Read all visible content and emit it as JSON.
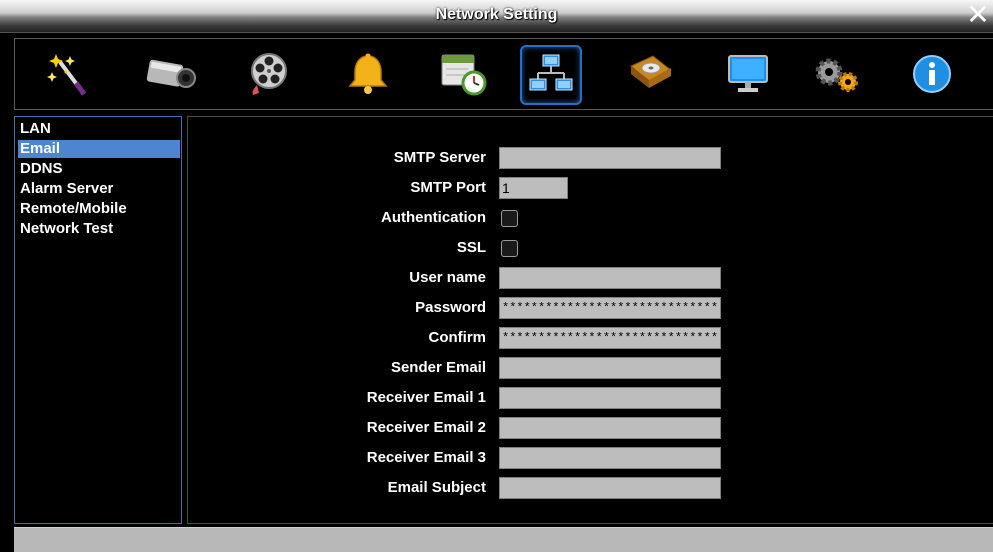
{
  "window": {
    "title": "Network Setting",
    "close_label": "✕"
  },
  "toolbar": {
    "items": [
      {
        "name": "wizard-icon"
      },
      {
        "name": "camera-icon"
      },
      {
        "name": "film-reel-icon"
      },
      {
        "name": "alarm-bell-icon"
      },
      {
        "name": "schedule-icon"
      },
      {
        "name": "network-icon",
        "active": true
      },
      {
        "name": "hard-disk-icon"
      },
      {
        "name": "monitor-icon"
      },
      {
        "name": "settings-gears-icon"
      },
      {
        "name": "info-icon"
      }
    ]
  },
  "sidebar": {
    "items": [
      {
        "label": "LAN"
      },
      {
        "label": "Email",
        "selected": true
      },
      {
        "label": "DDNS"
      },
      {
        "label": "Alarm Server"
      },
      {
        "label": "Remote/Mobile"
      },
      {
        "label": "Network Test"
      }
    ]
  },
  "form": {
    "smtp_server": {
      "label": "SMTP Server",
      "value": ""
    },
    "smtp_port": {
      "label": "SMTP Port",
      "value": "1"
    },
    "authentication": {
      "label": "Authentication",
      "checked": false
    },
    "ssl": {
      "label": "SSL",
      "checked": false
    },
    "user_name": {
      "label": "User name",
      "value": ""
    },
    "password": {
      "label": "Password",
      "value": "******************************"
    },
    "confirm": {
      "label": "Confirm",
      "value": "******************************"
    },
    "sender_email": {
      "label": "Sender Email",
      "value": ""
    },
    "receiver_email_1": {
      "label": "Receiver Email 1",
      "value": ""
    },
    "receiver_email_2": {
      "label": "Receiver Email 2",
      "value": ""
    },
    "receiver_email_3": {
      "label": "Receiver Email 3",
      "value": ""
    },
    "email_subject": {
      "label": "Email Subject",
      "value": ""
    }
  },
  "colors": {
    "accent": "#4d86d0",
    "field_bg": "#bdbdbd",
    "background": "#000000"
  }
}
